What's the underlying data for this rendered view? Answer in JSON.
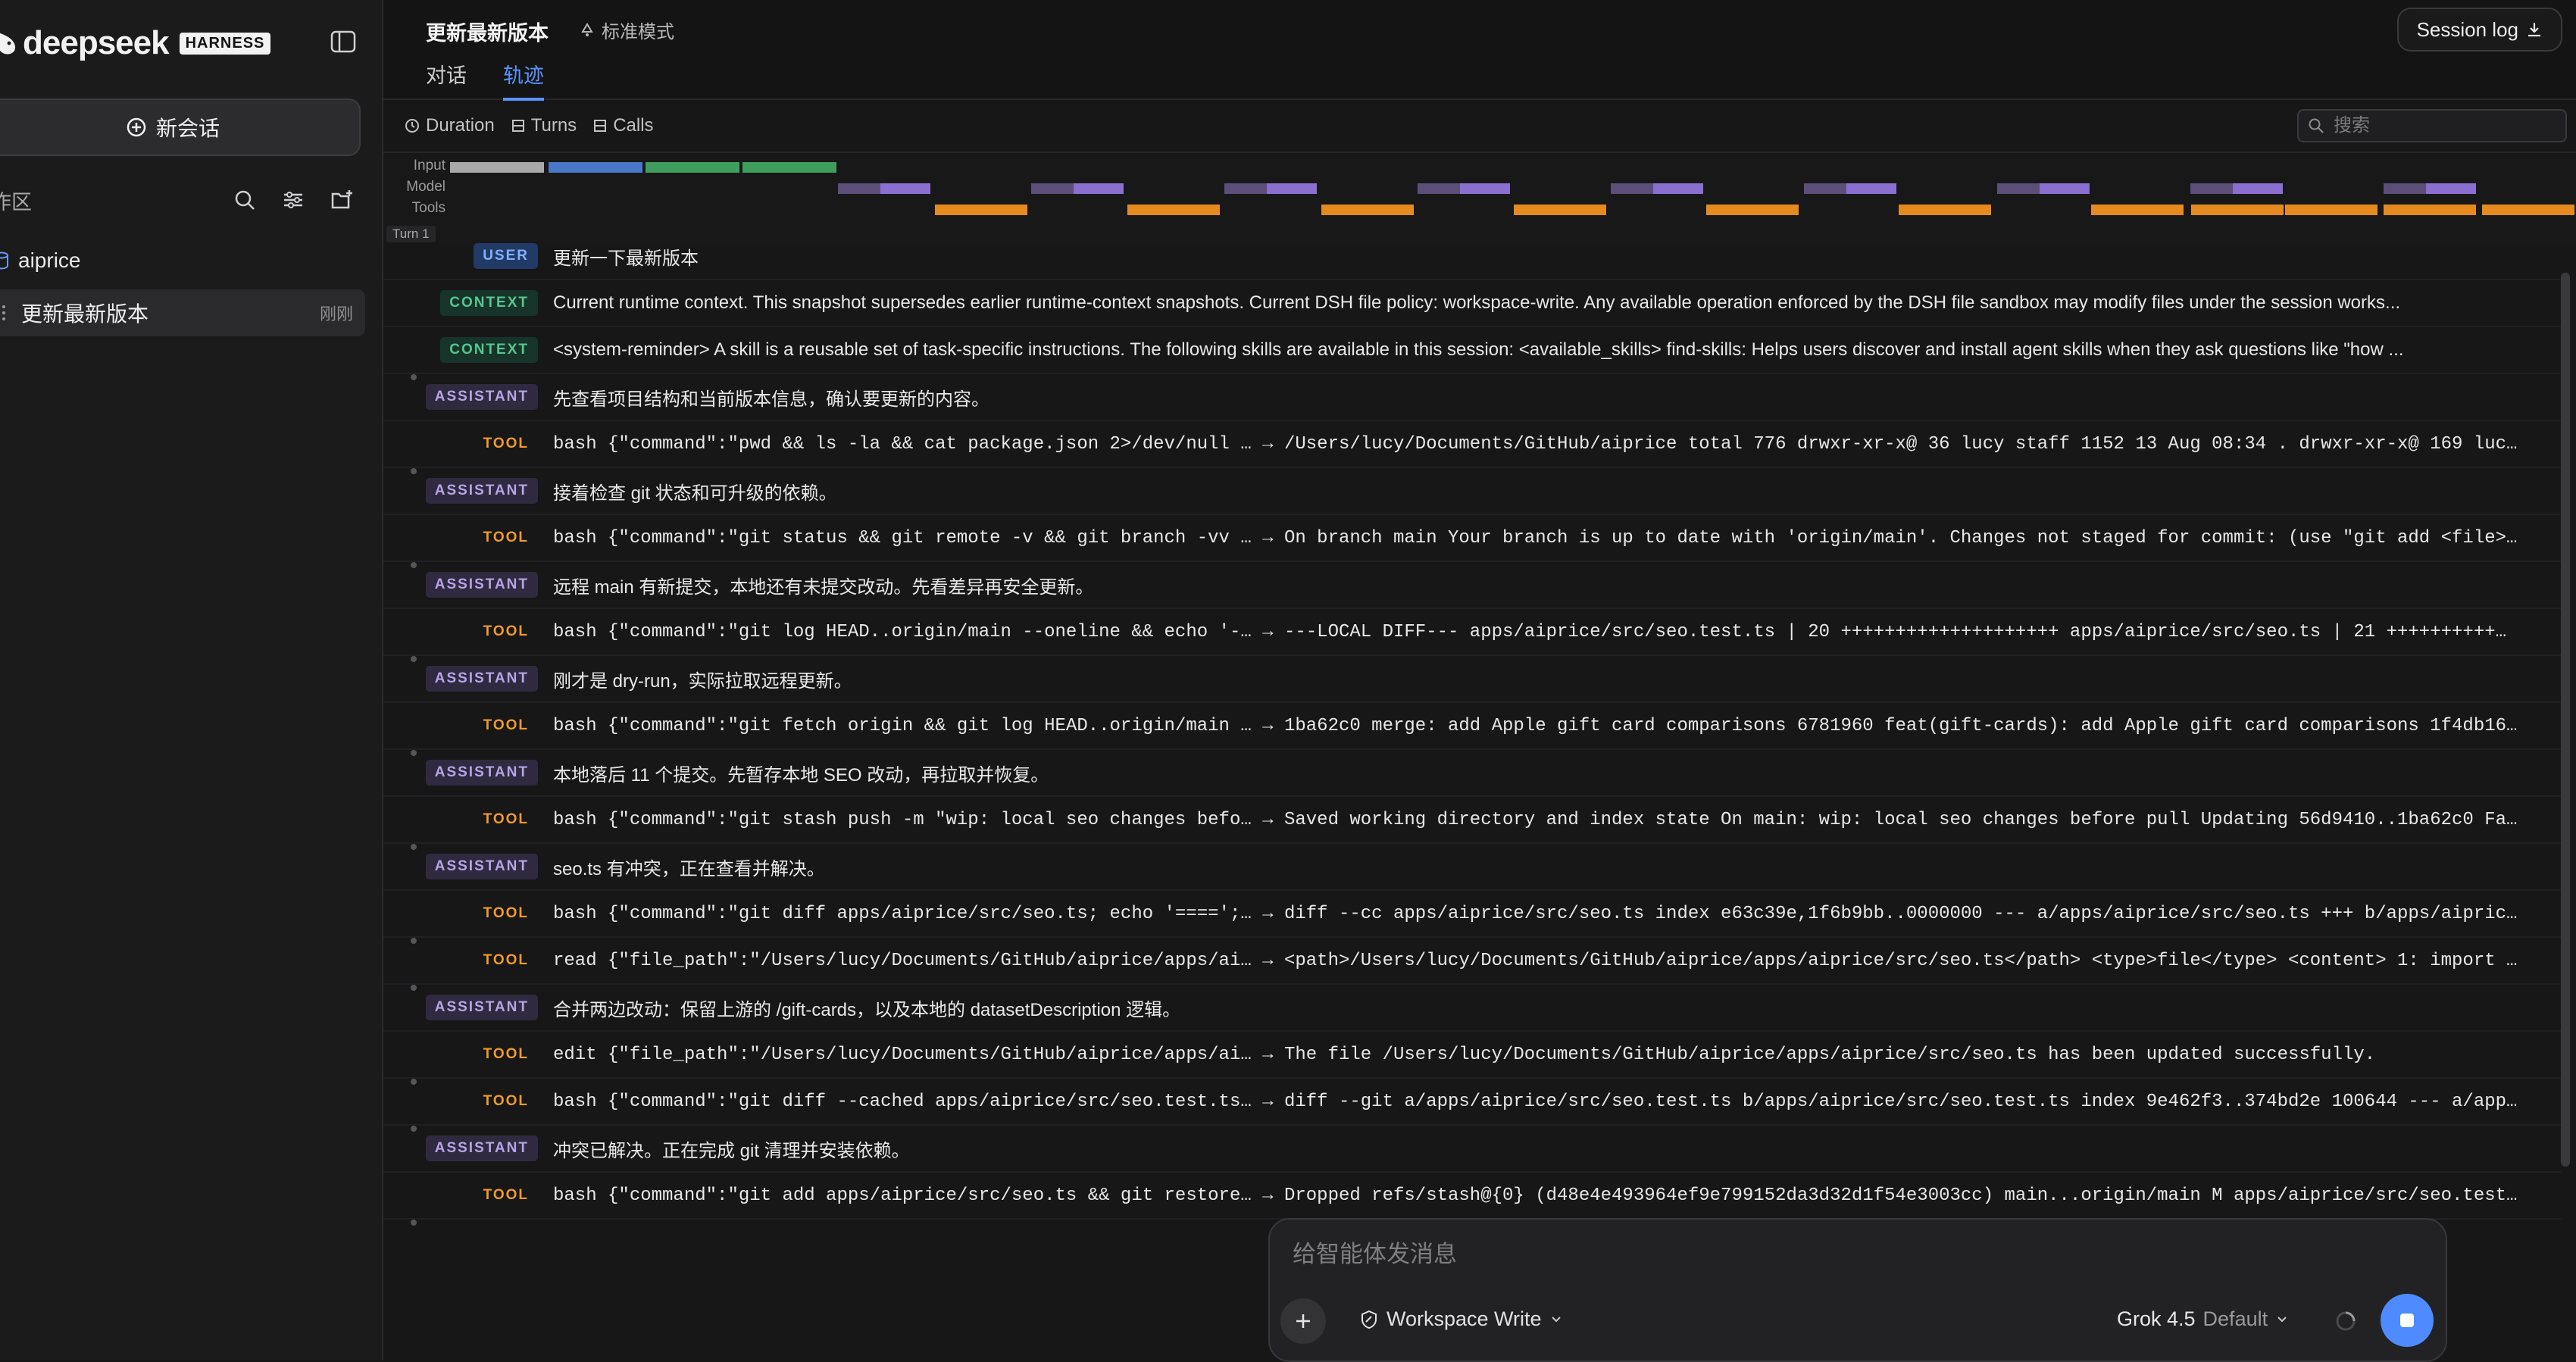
{
  "sidebar": {
    "brand_name": "deepseek",
    "brand_badge": "HARNESS",
    "new_chat_label": "新会话",
    "workspace_title": "作区",
    "project": "aiprice",
    "session_title": "更新最新版本",
    "session_time": "刚刚"
  },
  "header": {
    "title": "更新最新版本",
    "mode": "标准模式",
    "session_log": "Session log",
    "tabs": [
      {
        "label": "对话",
        "active": false
      },
      {
        "label": "轨迹",
        "active": true
      }
    ]
  },
  "toolbar": {
    "filters": [
      "Duration",
      "Turns",
      "Calls"
    ],
    "search_placeholder": "搜索"
  },
  "timeline": {
    "lanes": [
      "Input",
      "Model",
      "Tools"
    ],
    "turn_label": "Turn 1",
    "colors": {
      "input_gray": "#a9a9a9",
      "input_blue": "#4a78c9",
      "input_green": "#3f9e5e",
      "model": "#8a6fd1",
      "tool": "#e58a1f"
    }
  },
  "trace": [
    {
      "role": "USER",
      "kind": "user",
      "text": "更新一下最新版本"
    },
    {
      "role": "CONTEXT",
      "kind": "context",
      "text": "Current runtime context. This snapshot supersedes earlier runtime-context snapshots. Current DSH file policy: workspace-write. Any available operation enforced by the DSH file sandbox may modify files under the session works..."
    },
    {
      "role": "CONTEXT",
      "kind": "context",
      "text": "<system-reminder> A skill is a reusable set of task-specific instructions. The following skills are available in this session: <available_skills> find-skills: Helps users discover and install agent skills when they ask questions like \"how ..."
    },
    {
      "role": "ASSISTANT",
      "kind": "assistant",
      "text": "先查看项目结构和当前版本信息，确认要更新的内容。"
    },
    {
      "role": "TOOL",
      "kind": "tool",
      "text": "bash {\"command\":\"pwd && ls -la && cat package.json 2>/dev/null … → /Users/lucy/Documents/GitHub/aiprice total 776 drwxr-xr-x@ 36 lucy staff 1152 13 Aug 08:34 . drwxr-xr-x@ 169 luc…"
    },
    {
      "role": "ASSISTANT",
      "kind": "assistant",
      "text": "接着检查 git 状态和可升级的依赖。"
    },
    {
      "role": "TOOL",
      "kind": "tool",
      "text": "bash {\"command\":\"git status && git remote -v && git branch -vv … → On branch main Your branch is up to date with 'origin/main'. Changes not staged for commit: (use \"git add <file>…"
    },
    {
      "role": "ASSISTANT",
      "kind": "assistant",
      "text": "远程 main 有新提交，本地还有未提交改动。先看差异再安全更新。"
    },
    {
      "role": "TOOL",
      "kind": "tool",
      "text": "bash {\"command\":\"git log HEAD..origin/main --oneline && echo '-… → ---LOCAL DIFF--- apps/aiprice/src/seo.test.ts | 20 ++++++++++++++++++++ apps/aiprice/src/seo.ts | 21 ++++++++++…"
    },
    {
      "role": "ASSISTANT",
      "kind": "assistant",
      "text": "刚才是 dry-run，实际拉取远程更新。"
    },
    {
      "role": "TOOL",
      "kind": "tool",
      "text": "bash {\"command\":\"git fetch origin && git log HEAD..origin/main … → 1ba62c0 merge: add Apple gift card comparisons 6781960 feat(gift-cards): add Apple gift card comparisons 1f4db16…"
    },
    {
      "role": "ASSISTANT",
      "kind": "assistant",
      "text": "本地落后 11 个提交。先暂存本地 SEO 改动，再拉取并恢复。"
    },
    {
      "role": "TOOL",
      "kind": "tool",
      "text": "bash {\"command\":\"git stash push -m \"wip: local seo changes befo… → Saved working directory and index state On main: wip: local seo changes before pull Updating 56d9410..1ba62c0 Fa…"
    },
    {
      "role": "ASSISTANT",
      "kind": "assistant",
      "text": "seo.ts 有冲突，正在查看并解决。"
    },
    {
      "role": "TOOL",
      "kind": "tool",
      "text": "bash {\"command\":\"git diff apps/aiprice/src/seo.ts; echo '====';… → diff --cc apps/aiprice/src/seo.ts index e63c39e,1f6b9bb..0000000 --- a/apps/aiprice/src/seo.ts +++ b/apps/aipric…"
    },
    {
      "role": "TOOL",
      "kind": "tool",
      "text": "read {\"file_path\":\"/Users/lucy/Documents/GitHub/aiprice/apps/ai… → <path>/Users/lucy/Documents/GitHub/aiprice/apps/aiprice/src/seo.ts</path> <type>file</type> <content> 1: import …"
    },
    {
      "role": "ASSISTANT",
      "kind": "assistant",
      "text": "合并两边改动：保留上游的 /gift-cards，以及本地的 datasetDescription 逻辑。"
    },
    {
      "role": "TOOL",
      "kind": "tool",
      "text": "edit {\"file_path\":\"/Users/lucy/Documents/GitHub/aiprice/apps/ai… → The file /Users/lucy/Documents/GitHub/aiprice/apps/aiprice/src/seo.ts has been updated successfully."
    },
    {
      "role": "TOOL",
      "kind": "tool",
      "text": "bash {\"command\":\"git diff --cached apps/aiprice/src/seo.test.ts… → diff --git a/apps/aiprice/src/seo.test.ts b/apps/aiprice/src/seo.test.ts index 9e462f3..374bd2e 100644 --- a/app…"
    },
    {
      "role": "ASSISTANT",
      "kind": "assistant",
      "text": "冲突已解决。正在完成 git 清理并安装依赖。"
    },
    {
      "role": "TOOL",
      "kind": "tool",
      "text": "bash {\"command\":\"git add apps/aiprice/src/seo.ts && git restore… → Dropped refs/stash@{0} (d48e4e493964ef9e799152da3d32d1f54e3003cc) main...origin/main M apps/aiprice/src/seo.test…"
    }
  ],
  "composer": {
    "placeholder": "给智能体发消息",
    "permission": "Workspace Write",
    "model": "Grok 4.5",
    "model_default": "Default"
  }
}
